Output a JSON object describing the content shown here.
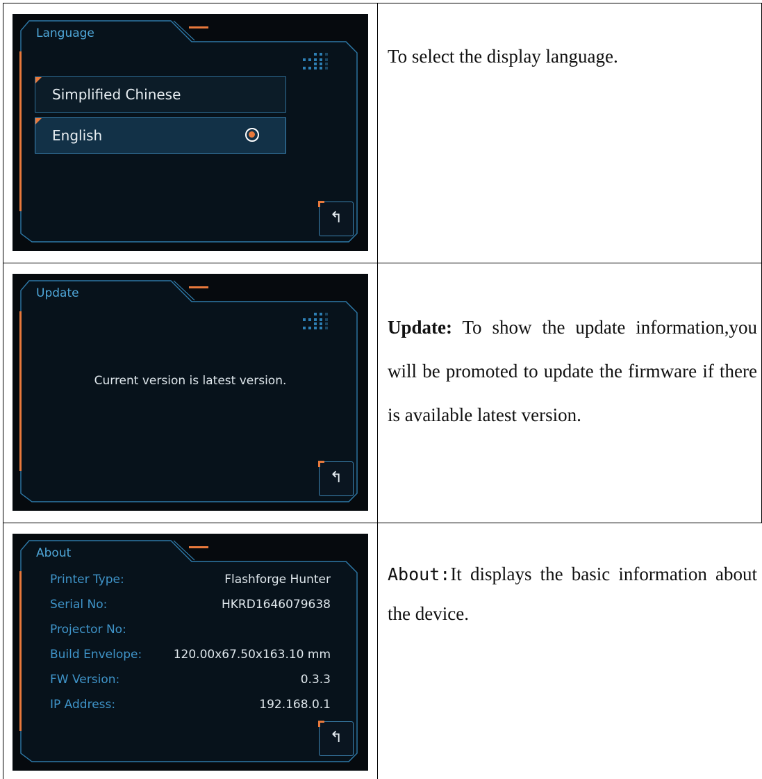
{
  "screens": {
    "language": {
      "title": "Language",
      "options": [
        {
          "label": "Simplified Chinese",
          "selected": false
        },
        {
          "label": "English",
          "selected": true
        }
      ],
      "back_icon": "↰"
    },
    "update": {
      "title": "Update",
      "message": "Current version is latest version.",
      "back_icon": "↰"
    },
    "about": {
      "title": "About",
      "rows": [
        {
          "key": "Printer Type:",
          "value": "Flashforge Hunter"
        },
        {
          "key": "Serial No:",
          "value": "HKRD1646079638"
        },
        {
          "key": "Projector No:",
          "value": ""
        },
        {
          "key": "Build Envelope:",
          "value": "120.00x67.50x163.10 mm"
        },
        {
          "key": "FW Version:",
          "value": "0.3.3"
        },
        {
          "key": "IP Address:",
          "value": "192.168.0.1"
        }
      ],
      "back_icon": "↰"
    }
  },
  "descriptions": {
    "language": {
      "text": "To select the display language."
    },
    "update": {
      "label": "Update:",
      "text": " To show the update information,you will be promoted to update the firmware if there is available latest version."
    },
    "about": {
      "label": "About:",
      "text": "It displays the basic information about the device."
    }
  },
  "colors": {
    "accent_orange": "#e8793c",
    "frame_blue": "#3d86b5",
    "label_blue": "#3f94c9",
    "screen_bg": "#060a0e"
  },
  "icons": {
    "back": "back-arrow-icon",
    "radio": "radio-selected-icon",
    "grid": "dot-grid-icon"
  }
}
